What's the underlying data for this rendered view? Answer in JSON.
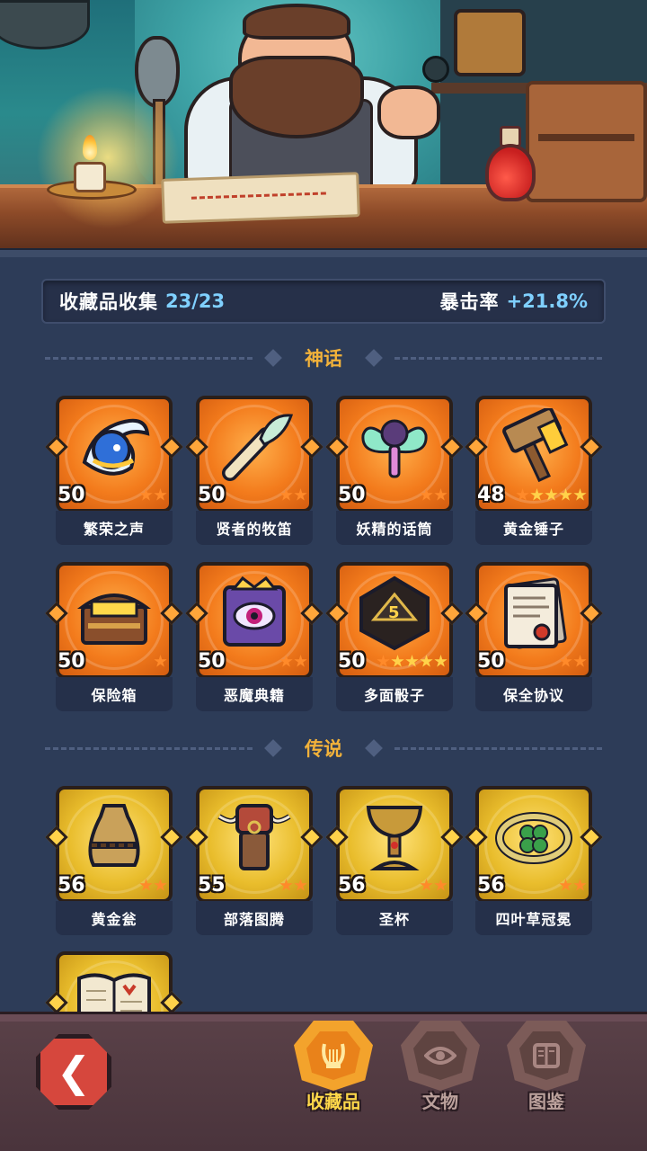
{
  "header": {
    "collection_label": "收藏品收集",
    "collection_count": "23/23",
    "crit_label": "暴击率",
    "crit_value": "+21.8%"
  },
  "sections": {
    "mythic_title": "神话",
    "legend_title": "传说"
  },
  "mythic_items": [
    {
      "name": "繁荣之声",
      "level": "50",
      "stars": 2,
      "icon": "blue-spirit-orb-icon"
    },
    {
      "name": "贤者的牧笛",
      "level": "50",
      "stars": 2,
      "icon": "sage-flute-icon"
    },
    {
      "name": "妖精的话筒",
      "level": "50",
      "stars": 2,
      "icon": "fairy-microphone-icon"
    },
    {
      "name": "黄金锤子",
      "level": "48",
      "stars": 5,
      "icon": "golden-hammer-icon"
    },
    {
      "name": "保险箱",
      "level": "50",
      "stars": 1,
      "icon": "treasure-chest-icon"
    },
    {
      "name": "恶魔典籍",
      "level": "50",
      "stars": 2,
      "icon": "demon-tome-icon"
    },
    {
      "name": "多面骰子",
      "level": "50",
      "stars": 5,
      "icon": "polyhedral-dice-icon"
    },
    {
      "name": "保全协议",
      "level": "50",
      "stars": 2,
      "icon": "contract-scroll-icon"
    }
  ],
  "legend_items": [
    {
      "name": "黄金瓮",
      "level": "56",
      "stars": 2,
      "icon": "golden-urn-icon"
    },
    {
      "name": "部落图腾",
      "level": "55",
      "stars": 2,
      "icon": "tribal-totem-icon"
    },
    {
      "name": "圣杯",
      "level": "56",
      "stars": 2,
      "icon": "holy-grail-icon"
    },
    {
      "name": "四叶草冠冕",
      "level": "56",
      "stars": 2,
      "icon": "clover-crown-icon"
    },
    {
      "icon": "open-book-icon"
    }
  ],
  "nav": {
    "tab_collectibles": "收藏品",
    "tab_relics": "文物",
    "tab_codex": "图鉴"
  },
  "colors": {
    "mythic_frame": "#f37b1c",
    "legend_frame": "#e9bd2c",
    "accent_gold": "#f2b23a",
    "stat_blue": "#7fd0ff"
  }
}
